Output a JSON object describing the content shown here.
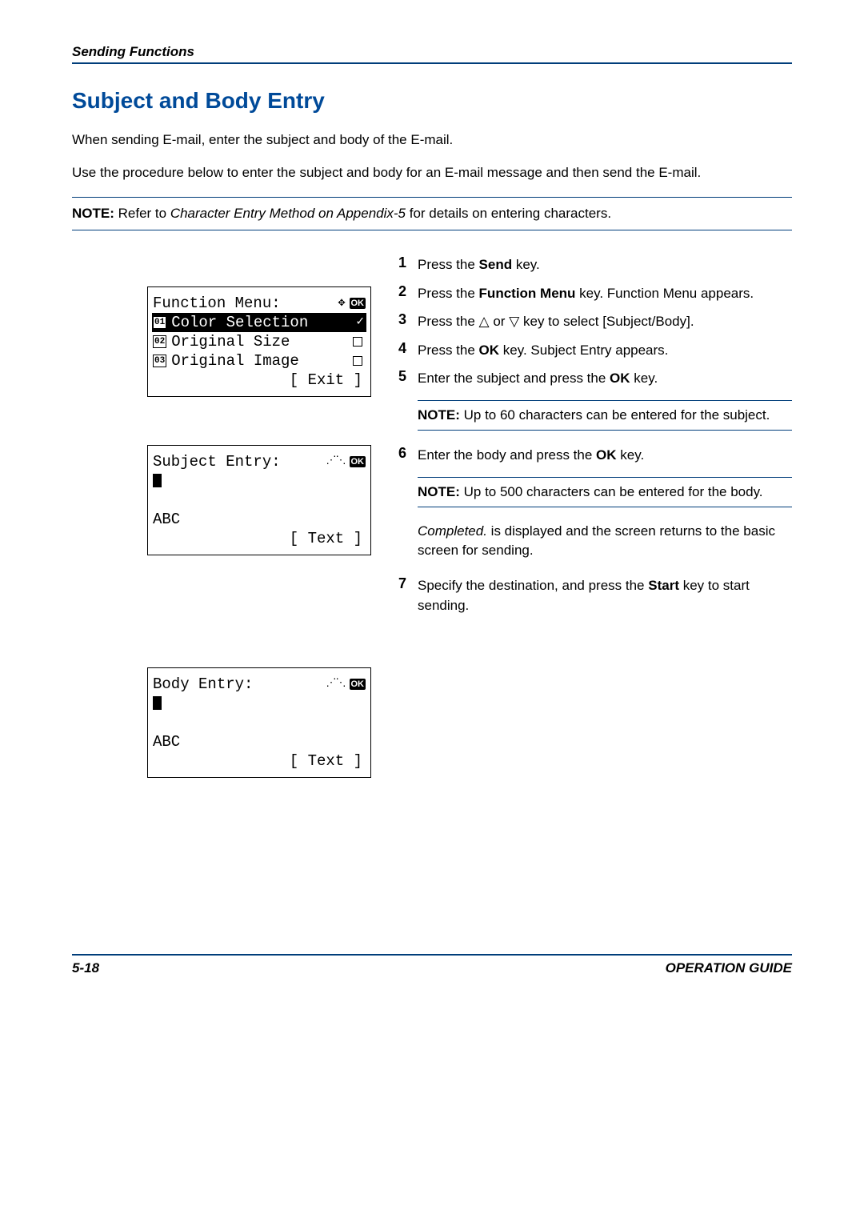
{
  "header": {
    "section": "Sending Functions",
    "title": "Subject and Body Entry"
  },
  "intro": {
    "p1": "When sending E-mail, enter the subject and body of the E-mail.",
    "p2": "Use the procedure below to enter the subject and body for an E-mail message and then send the E-mail."
  },
  "topnote": {
    "label": "NOTE:",
    "pre": " Refer to ",
    "ref": "Character Entry Method on Appendix-5",
    "post": " for details on entering characters."
  },
  "lcd1": {
    "title": "Function Menu:",
    "ok": "OK",
    "item1_num": "01",
    "item1": "Color Selection",
    "item2_num": "02",
    "item2": "Original Size",
    "item3_num": "03",
    "item3": "Original Image",
    "soft": "[  Exit   ]"
  },
  "lcd2": {
    "title": "Subject Entry:",
    "ok": "OK",
    "mode": "ABC",
    "soft": "[  Text   ]"
  },
  "lcd3": {
    "title": "Body Entry:",
    "ok": "OK",
    "mode": "ABC",
    "soft": "[  Text   ]"
  },
  "steps": {
    "s1": {
      "num": "1",
      "a": "Press the ",
      "b": "Send",
      "c": " key."
    },
    "s2": {
      "num": "2",
      "a": "Press the ",
      "b": "Function Menu",
      "c": " key. Function Menu appears."
    },
    "s3": {
      "num": "3",
      "a": "Press the ",
      "up": "△",
      "mid": " or ",
      "down": "▽",
      "c": " key to select [Subject/Body]."
    },
    "s4": {
      "num": "4",
      "a": "Press the ",
      "b": "OK",
      "c": " key. Subject Entry appears."
    },
    "s5": {
      "num": "5",
      "a": "Enter the subject and press the ",
      "b": "OK",
      "c": " key."
    },
    "s6": {
      "num": "6",
      "a": "Enter the body and press the ",
      "b": "OK",
      "c": " key."
    },
    "s7": {
      "num": "7",
      "a": "Specify the destination, and press the ",
      "b": "Start",
      "c": " key to start sending."
    }
  },
  "note_subject": {
    "label": "NOTE:",
    "text": " Up to 60 characters can be entered for the subject."
  },
  "note_body": {
    "label": "NOTE:",
    "text": " Up to 500 characters can be entered for the body."
  },
  "completed": {
    "label": "Completed.",
    "text": " is displayed and the screen returns to the basic screen for sending."
  },
  "footer": {
    "page": "5-18",
    "guide": "OPERATION GUIDE"
  }
}
